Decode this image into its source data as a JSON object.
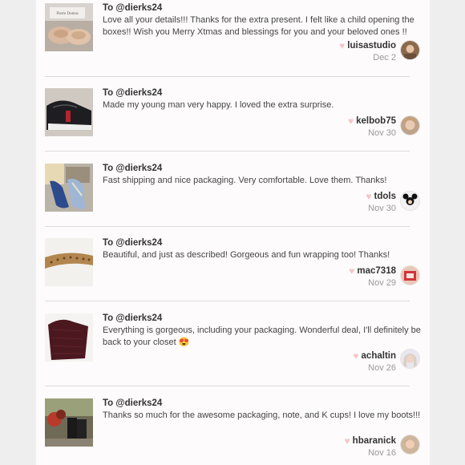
{
  "reviews": [
    {
      "to": "To @dierks24",
      "message": "Love all your details!!! Thanks for the extra present. I felt like a child opening the boxes!! Wish you Merry Xtmas and blessings for you and your beloved ones !!",
      "username": "luisastudio",
      "date": "Dec 2",
      "thumb_label": "Pierre Dumas"
    },
    {
      "to": "To @dierks24",
      "message": "Made my young man very happy. I loved the extra surprise.",
      "username": "kelbob75",
      "date": "Nov 30"
    },
    {
      "to": "To @dierks24",
      "message": "Fast shipping and nice packaging. Very comfortable. Love them. Thanks!",
      "username": "tdols",
      "date": "Nov 30"
    },
    {
      "to": "To @dierks24",
      "message": "Beautiful, and just as described! Gorgeous and fun wrapping too! Thanks!",
      "username": "mac7318",
      "date": "Nov 29"
    },
    {
      "to": "To @dierks24",
      "message": "Everything is gorgeous, including your packaging. Wonderful deal, I'll definitely be back to your closet 😍",
      "username": "achaltin",
      "date": "Nov 26"
    },
    {
      "to": "To @dierks24",
      "message": "Thanks so much for the awesome packaging, note, and K cups! I love my boots!!!",
      "username": "hbaranick",
      "date": "Nov 16"
    }
  ],
  "colors": {
    "background": "#efeeee",
    "panel": "#fdfbfb",
    "heart": "#f2c6c9",
    "date": "#999999"
  }
}
